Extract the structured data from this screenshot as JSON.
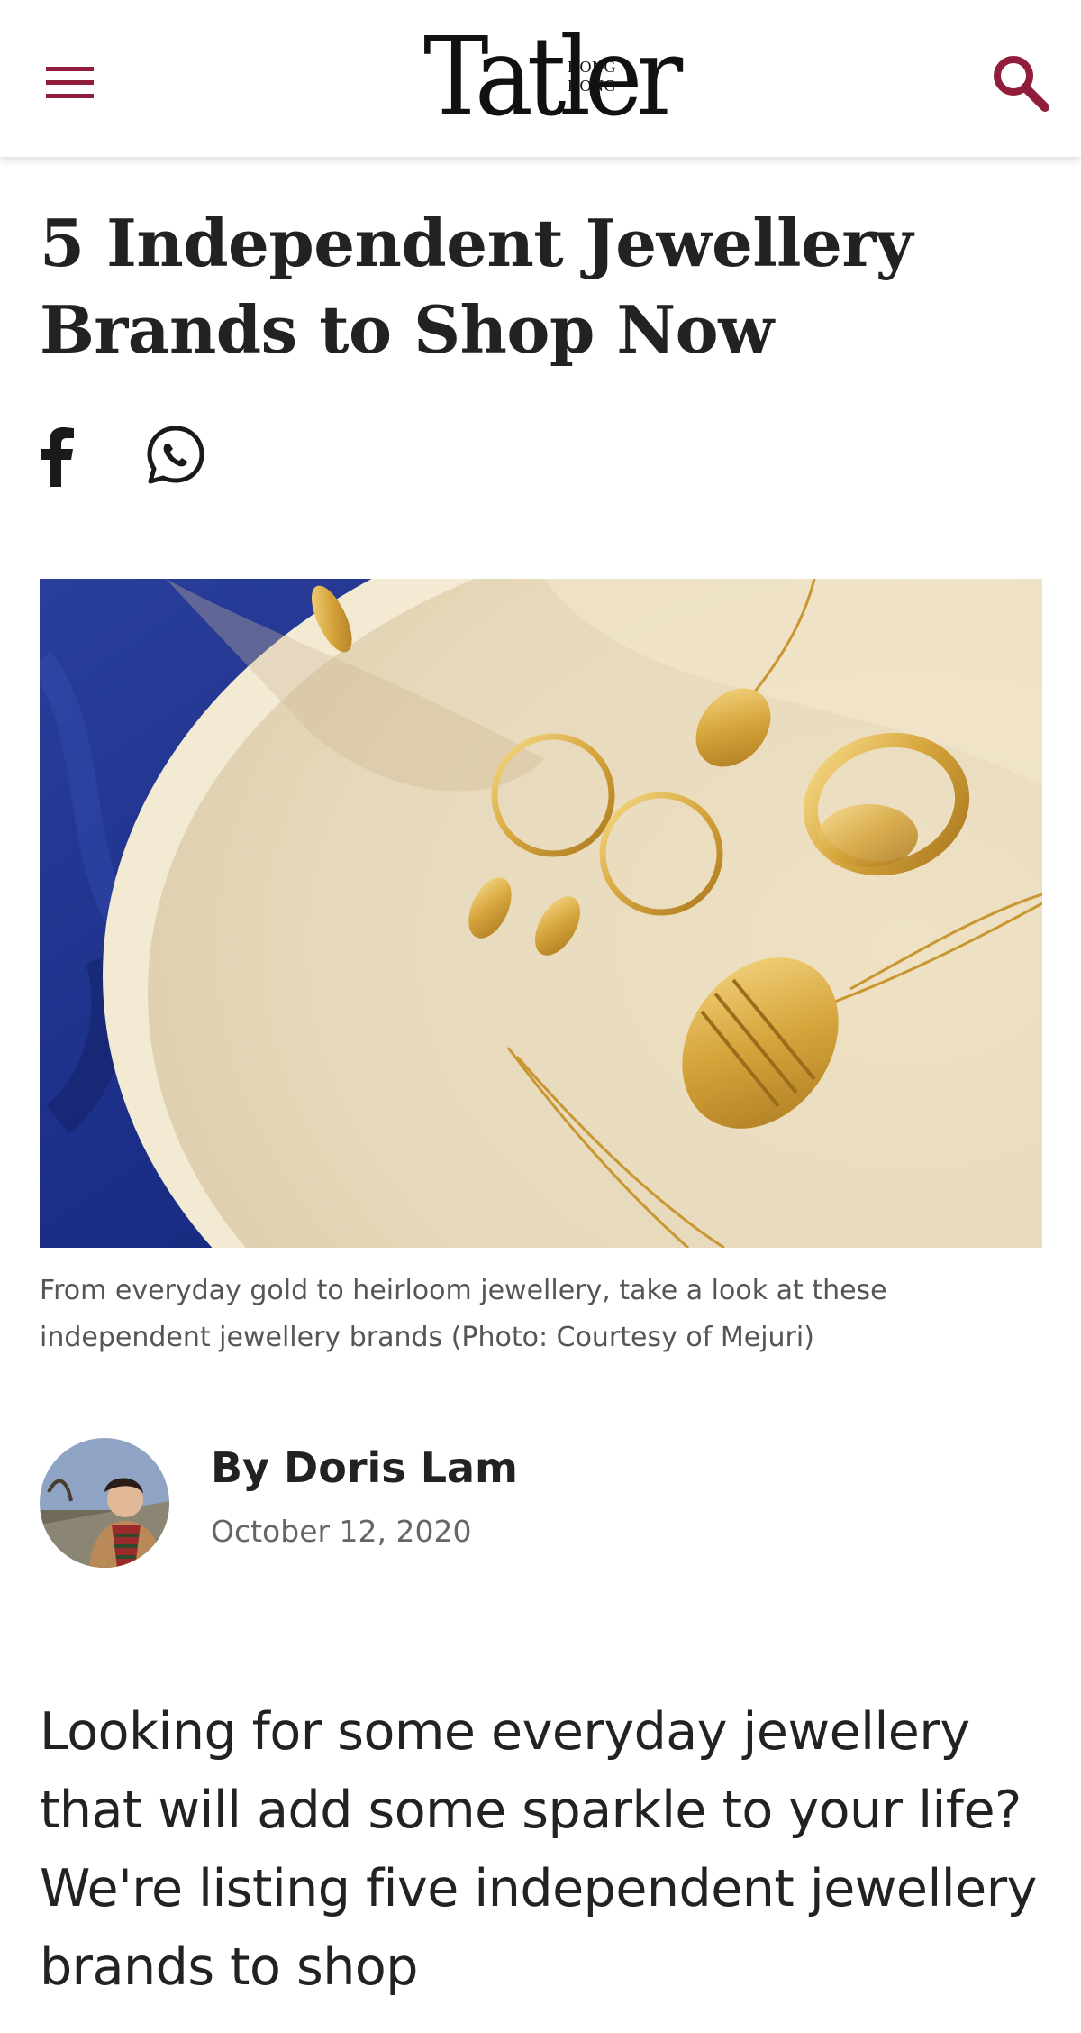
{
  "header": {
    "logo_main": "Tatler",
    "logo_sub": "HONG KONG",
    "accent_color": "#8f1d3b"
  },
  "article": {
    "title": "5 Independent Jewellery Brands to Shop Now",
    "share": {
      "facebook_icon": "facebook-icon",
      "whatsapp_icon": "whatsapp-icon"
    },
    "caption": "From everyday gold to heirloom jewellery, take a look at these independent jewellery brands (Photo: Courtesy of Mejuri)",
    "author": {
      "byline": "By Doris Lam",
      "date": "October 12, 2020"
    },
    "intro": "Looking for some everyday jewellery that will add some sparkle to your life? We're listing five independent jewellery brands to shop"
  }
}
